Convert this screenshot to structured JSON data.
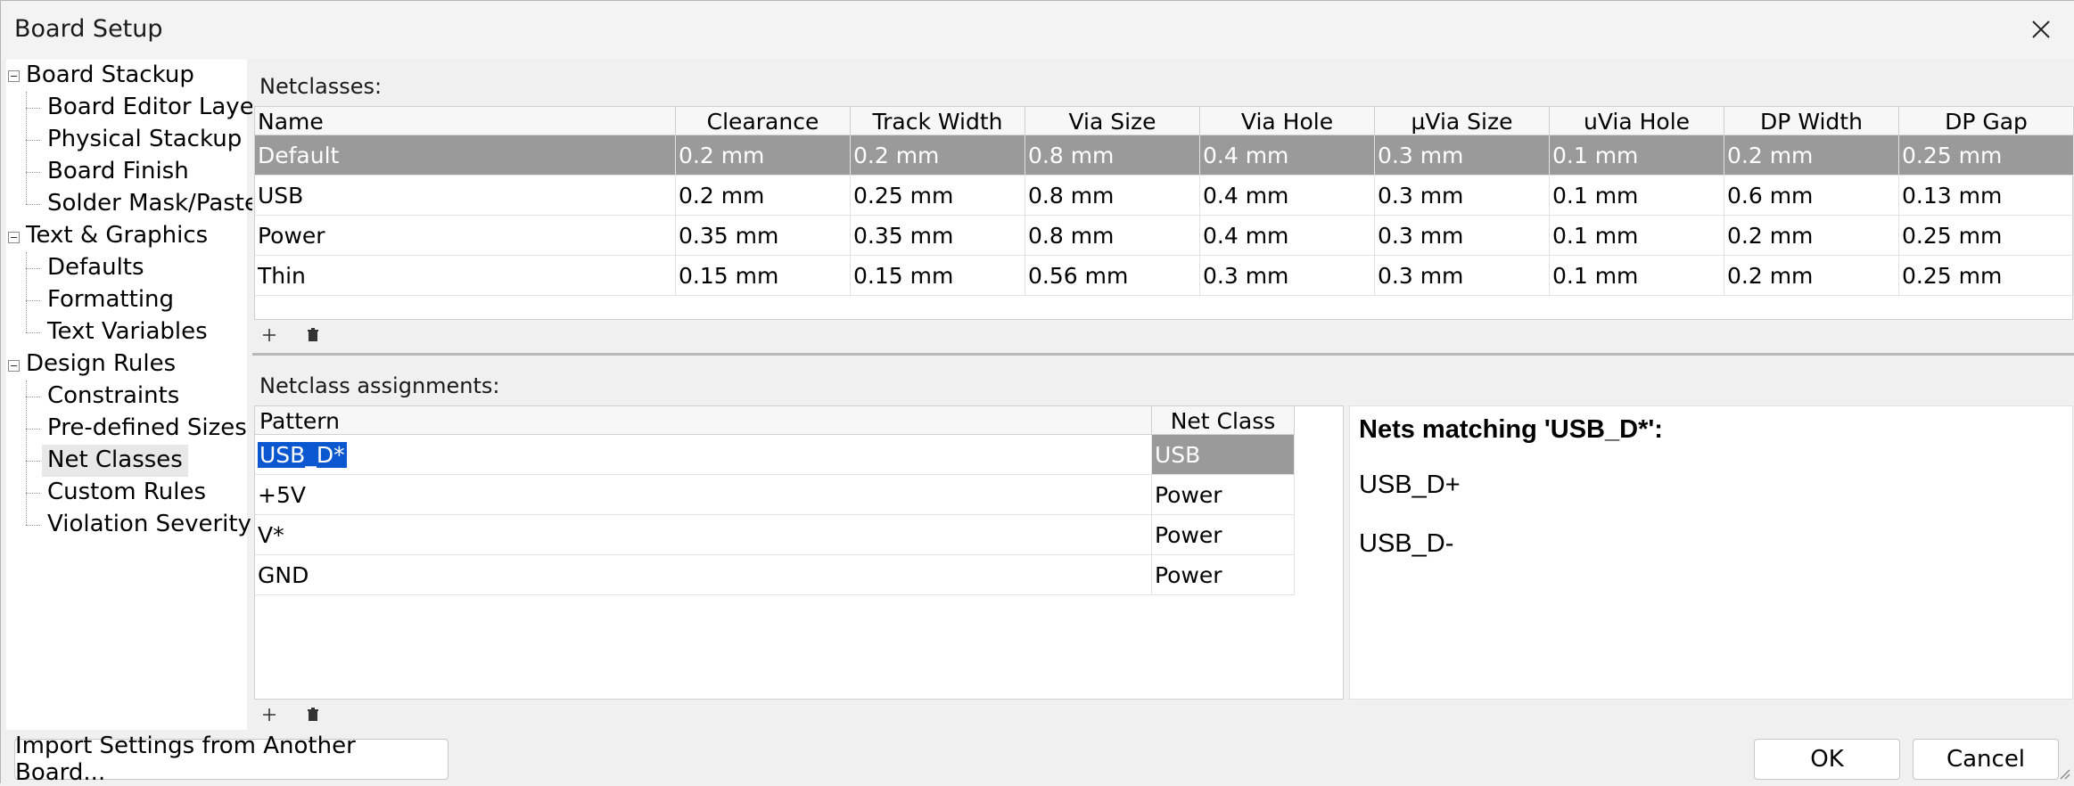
{
  "window": {
    "title": "Board Setup"
  },
  "sidebar": {
    "groups": [
      {
        "label": "Board Stackup",
        "items": [
          "Board Editor Layers",
          "Physical Stackup",
          "Board Finish",
          "Solder Mask/Paste"
        ]
      },
      {
        "label": "Text & Graphics",
        "items": [
          "Defaults",
          "Formatting",
          "Text Variables"
        ]
      },
      {
        "label": "Design Rules",
        "items": [
          "Constraints",
          "Pre-defined Sizes",
          "Net Classes",
          "Custom Rules",
          "Violation Severity"
        ]
      }
    ],
    "selected": "Net Classes"
  },
  "netclasses": {
    "label": "Netclasses:",
    "columns": [
      "Name",
      "Clearance",
      "Track Width",
      "Via Size",
      "Via Hole",
      "µVia Size",
      "uVia Hole",
      "DP Width",
      "DP Gap"
    ],
    "rows": [
      [
        "Default",
        "0.2 mm",
        "0.2 mm",
        "0.8 mm",
        "0.4 mm",
        "0.3 mm",
        "0.1 mm",
        "0.2 mm",
        "0.25 mm"
      ],
      [
        "USB",
        "0.2 mm",
        "0.25 mm",
        "0.8 mm",
        "0.4 mm",
        "0.3 mm",
        "0.1 mm",
        "0.6 mm",
        "0.13 mm"
      ],
      [
        "Power",
        "0.35 mm",
        "0.35 mm",
        "0.8 mm",
        "0.4 mm",
        "0.3 mm",
        "0.1 mm",
        "0.2 mm",
        "0.25 mm"
      ],
      [
        "Thin",
        "0.15 mm",
        "0.15 mm",
        "0.56 mm",
        "0.3 mm",
        "0.3 mm",
        "0.1 mm",
        "0.2 mm",
        "0.25 mm"
      ]
    ],
    "selected_row": 0
  },
  "assignments": {
    "label": "Netclass assignments:",
    "columns": [
      "Pattern",
      "Net Class"
    ],
    "rows": [
      [
        "USB_D*",
        "USB"
      ],
      [
        "+5V",
        "Power"
      ],
      [
        "V*",
        "Power"
      ],
      [
        "GND",
        "Power"
      ]
    ],
    "selected_row": 0
  },
  "nets_panel": {
    "title": "Nets matching 'USB_D*':",
    "nets": [
      "USB_D+",
      "USB_D-"
    ]
  },
  "buttons": {
    "import": "Import Settings from Another Board...",
    "ok": "OK",
    "cancel": "Cancel"
  },
  "icons": {
    "add": "plus-icon",
    "delete": "trash-icon",
    "close": "close-icon"
  }
}
